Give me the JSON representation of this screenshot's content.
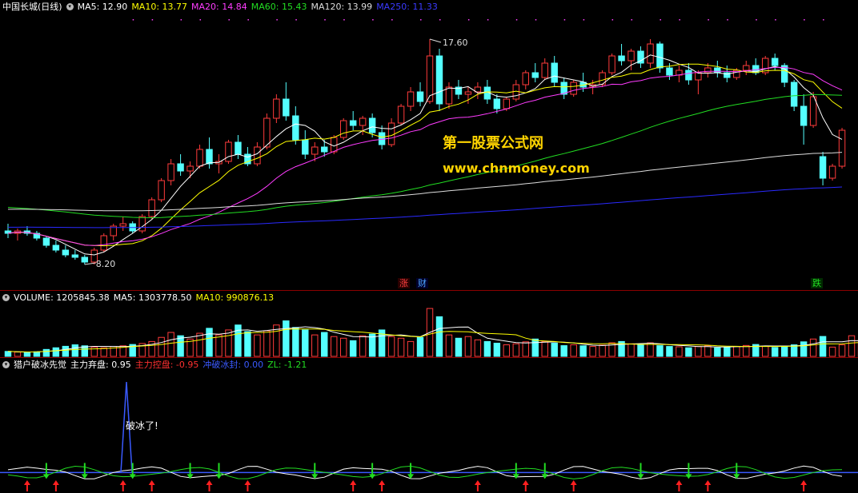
{
  "colors": {
    "up": "#ff3b3b",
    "down": "#54ffff",
    "ma5": "#ffffff",
    "ma10": "#ffff00",
    "ma20": "#ff3cff",
    "ma60": "#22dd22",
    "ma120": "#dddddd",
    "ma250": "#2a2aff",
    "text": "#dddddd"
  },
  "price_header": {
    "title": "中国长城(日线)",
    "ma5": "MA5: 12.90",
    "ma10": "MA10: 13.77",
    "ma20": "MA20: 14.84",
    "ma60": "MA60: 15.43",
    "ma120": "MA120: 13.99",
    "ma250": "MA250: 11.33"
  },
  "price_labels": {
    "high": "17.60",
    "low": "8.20"
  },
  "event_markers": [
    {
      "text": "涨",
      "color": "#ff4040"
    },
    {
      "text": "财",
      "color": "#4da6ff"
    },
    {
      "text": "跌",
      "color": "#22dd22"
    }
  ],
  "watermark": {
    "line1": "第一股票公式网",
    "line2": "www.chnmoney.com"
  },
  "volume_header": {
    "title": "VOLUME: 1205845.38",
    "ma5": "MA5: 1303778.50",
    "ma10": "MA10: 990876.13"
  },
  "indicator_header": {
    "title": "猎户破冰先觉",
    "zlqp": "主力弃盘: 0.95",
    "zlkp": "主力控盘: -0.95",
    "cpbf": "冲破冰封: 0.00",
    "zl": "ZL: -1.21"
  },
  "indicator_annotation": "破冰了!",
  "chart_data": [
    {
      "type": "candlestick",
      "series": [
        {
          "name": "MA5"
        },
        {
          "name": "MA10"
        },
        {
          "name": "MA20"
        },
        {
          "name": "MA60"
        },
        {
          "name": "MA120"
        },
        {
          "name": "MA250"
        }
      ],
      "ylim": [
        7.5,
        18.5
      ],
      "extremes": {
        "high": 17.6,
        "low": 8.2
      },
      "candles": [
        [
          9.6,
          9.9,
          9.3,
          9.5
        ],
        [
          9.5,
          9.7,
          9.2,
          9.6
        ],
        [
          9.6,
          9.8,
          9.4,
          9.5
        ],
        [
          9.5,
          9.6,
          9.2,
          9.3
        ],
        [
          9.3,
          9.4,
          8.9,
          9.0
        ],
        [
          9.0,
          9.2,
          8.7,
          8.8
        ],
        [
          8.8,
          9.0,
          8.5,
          8.6
        ],
        [
          8.6,
          8.8,
          8.4,
          8.5
        ],
        [
          8.5,
          8.6,
          8.2,
          8.3
        ],
        [
          8.3,
          8.9,
          8.2,
          8.8
        ],
        [
          8.8,
          9.5,
          8.7,
          9.4
        ],
        [
          9.4,
          9.9,
          9.2,
          9.8
        ],
        [
          9.8,
          10.2,
          9.6,
          9.9
        ],
        [
          9.9,
          10.0,
          9.5,
          9.6
        ],
        [
          9.6,
          10.3,
          9.5,
          10.2
        ],
        [
          10.2,
          11.0,
          10.1,
          10.9
        ],
        [
          10.9,
          11.8,
          10.8,
          11.7
        ],
        [
          11.7,
          12.6,
          11.5,
          12.4
        ],
        [
          12.4,
          12.8,
          11.9,
          12.1
        ],
        [
          12.1,
          12.5,
          11.8,
          12.3
        ],
        [
          12.3,
          13.2,
          12.2,
          13.0
        ],
        [
          13.0,
          13.5,
          12.2,
          12.4
        ],
        [
          12.4,
          12.8,
          12.0,
          12.5
        ],
        [
          12.5,
          13.4,
          12.4,
          13.3
        ],
        [
          13.3,
          13.6,
          12.6,
          12.8
        ],
        [
          12.8,
          13.1,
          12.3,
          12.4
        ],
        [
          12.4,
          13.3,
          12.3,
          13.1
        ],
        [
          13.1,
          14.5,
          13.0,
          14.3
        ],
        [
          14.3,
          15.3,
          14.1,
          15.1
        ],
        [
          15.1,
          15.8,
          14.2,
          14.4
        ],
        [
          14.4,
          14.8,
          13.2,
          13.4
        ],
        [
          13.4,
          13.8,
          12.6,
          12.8
        ],
        [
          12.8,
          13.3,
          12.5,
          13.1
        ],
        [
          13.1,
          13.4,
          12.7,
          12.9
        ],
        [
          12.9,
          13.6,
          12.8,
          13.5
        ],
        [
          13.5,
          14.3,
          13.4,
          14.2
        ],
        [
          14.2,
          14.6,
          13.8,
          14.0
        ],
        [
          14.0,
          14.4,
          13.6,
          14.3
        ],
        [
          14.3,
          14.5,
          13.5,
          13.7
        ],
        [
          13.7,
          14.0,
          13.0,
          13.2
        ],
        [
          13.2,
          14.3,
          13.1,
          14.1
        ],
        [
          14.1,
          14.9,
          14.0,
          14.8
        ],
        [
          14.8,
          15.6,
          14.6,
          15.4
        ],
        [
          15.4,
          15.8,
          14.8,
          15.0
        ],
        [
          15.0,
          17.6,
          14.9,
          16.9
        ],
        [
          16.9,
          17.2,
          14.6,
          14.9
        ],
        [
          14.9,
          15.8,
          14.7,
          15.6
        ],
        [
          15.6,
          15.9,
          15.1,
          15.3
        ],
        [
          15.3,
          15.6,
          14.9,
          15.4
        ],
        [
          15.4,
          15.8,
          15.1,
          15.6
        ],
        [
          15.6,
          15.9,
          14.9,
          15.1
        ],
        [
          15.1,
          15.3,
          14.5,
          14.7
        ],
        [
          14.7,
          15.2,
          14.6,
          15.1
        ],
        [
          15.1,
          15.9,
          15.0,
          15.7
        ],
        [
          15.7,
          16.3,
          15.5,
          16.2
        ],
        [
          16.2,
          16.6,
          15.8,
          16.0
        ],
        [
          16.0,
          16.8,
          15.9,
          16.6
        ],
        [
          16.6,
          16.9,
          15.6,
          15.8
        ],
        [
          15.8,
          16.0,
          15.1,
          15.3
        ],
        [
          15.3,
          15.9,
          15.2,
          15.8
        ],
        [
          15.8,
          16.2,
          15.4,
          15.6
        ],
        [
          15.6,
          15.9,
          15.3,
          15.7
        ],
        [
          15.7,
          16.3,
          15.6,
          16.2
        ],
        [
          16.2,
          17.0,
          16.1,
          16.9
        ],
        [
          16.9,
          17.4,
          16.5,
          16.7
        ],
        [
          16.7,
          17.2,
          16.3,
          17.1
        ],
        [
          17.1,
          17.3,
          16.4,
          16.6
        ],
        [
          16.6,
          17.6,
          16.4,
          17.4
        ],
        [
          17.4,
          17.5,
          16.2,
          16.4
        ],
        [
          16.4,
          16.6,
          15.9,
          16.1
        ],
        [
          16.1,
          16.5,
          15.8,
          16.3
        ],
        [
          16.3,
          16.6,
          15.7,
          15.9
        ],
        [
          15.9,
          16.3,
          15.3,
          16.2
        ],
        [
          16.2,
          16.6,
          16.0,
          16.4
        ],
        [
          16.4,
          16.7,
          16.0,
          16.2
        ],
        [
          16.2,
          16.5,
          15.8,
          16.0
        ],
        [
          16.0,
          16.4,
          15.9,
          16.3
        ],
        [
          16.3,
          16.7,
          16.1,
          16.5
        ],
        [
          16.5,
          16.8,
          16.1,
          16.2
        ],
        [
          16.2,
          16.9,
          16.1,
          16.8
        ],
        [
          16.8,
          17.0,
          16.3,
          16.5
        ],
        [
          16.5,
          16.6,
          15.6,
          15.8
        ],
        [
          15.8,
          15.9,
          14.6,
          14.8
        ],
        [
          14.8,
          15.3,
          13.2,
          14.0
        ],
        [
          14.0,
          15.4,
          13.9,
          15.2
        ],
        [
          12.7,
          12.9,
          11.5,
          11.8
        ],
        [
          11.8,
          12.4,
          11.7,
          12.3
        ],
        [
          12.3,
          13.9,
          12.2,
          13.8
        ]
      ]
    },
    {
      "type": "bar",
      "title": "VOLUME",
      "series": [
        {
          "name": "MA5"
        },
        {
          "name": "MA10"
        }
      ],
      "ylim": [
        0,
        3000000
      ],
      "values": [
        300000,
        260000,
        240000,
        280000,
        420000,
        520000,
        610000,
        700000,
        640000,
        560000,
        520000,
        600000,
        640000,
        720000,
        780000,
        900000,
        1150000,
        1450000,
        1250000,
        1050000,
        1400000,
        1700000,
        1300000,
        1600000,
        1900000,
        1500000,
        1300000,
        1550000,
        1900000,
        2150000,
        1750000,
        1600000,
        1300000,
        1450000,
        1200000,
        1100000,
        950000,
        1250000,
        1350000,
        1600000,
        1200000,
        1100000,
        900000,
        1150000,
        2900000,
        2400000,
        1300000,
        1100000,
        1200000,
        1000000,
        900000,
        800000,
        700000,
        760000,
        880000,
        1050000,
        900000,
        800000,
        650000,
        700000,
        640000,
        600000,
        680000,
        820000,
        900000,
        760000,
        700000,
        820000,
        650000,
        600000,
        580000,
        520000,
        600000,
        640000,
        520000,
        560000,
        600000,
        660000,
        720000,
        620000,
        540000,
        600000,
        700000,
        880000,
        1050000,
        1205845,
        560000,
        700000,
        1250000,
        1000000
      ]
    },
    {
      "type": "line",
      "title": "猎户破冰先觉",
      "series": [
        {
          "name": "主力弃盘"
        },
        {
          "name": "主力控盘"
        },
        {
          "name": "冲破冰封"
        },
        {
          "name": "ZL"
        }
      ],
      "ylim": [
        -1.6,
        9.0
      ]
    }
  ]
}
